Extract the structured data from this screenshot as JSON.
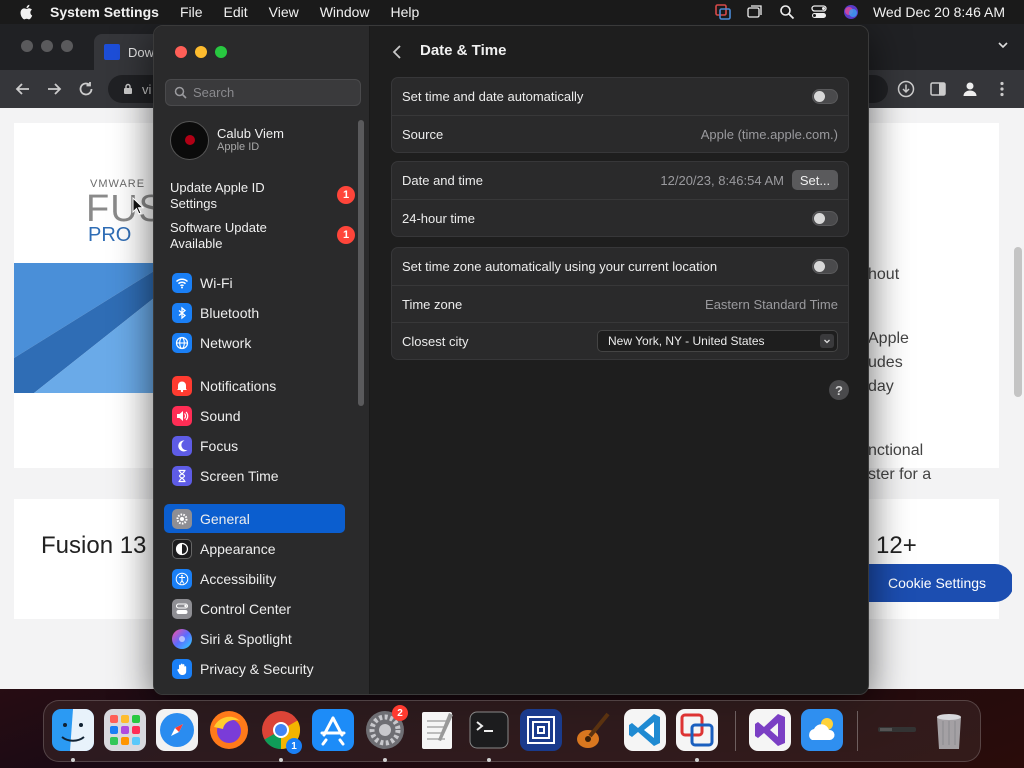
{
  "menubar": {
    "app_name": "System Settings",
    "menus": [
      "File",
      "Edit",
      "View",
      "Window",
      "Help"
    ],
    "clock": "Wed Dec 20  8:46 AM"
  },
  "browser": {
    "tab_title": "Dow",
    "omnibox_text": "vi",
    "hero": {
      "logo_brand": "VMWARE",
      "logo_product": "FUS",
      "logo_edition": "PRO",
      "right_text": [
        "hout",
        "Apple",
        "udes",
        "day",
        "nctional",
        "ster for a"
      ]
    },
    "bottom": {
      "left_heading": "Fusion 13",
      "right_heading": "12+",
      "cookie_button": "Cookie Settings"
    }
  },
  "settings": {
    "search_placeholder": "Search",
    "profile": {
      "name": "Calub Viem",
      "subtitle": "Apple ID"
    },
    "notices": [
      {
        "line1": "Update Apple ID",
        "line2": "Settings",
        "badge": "1"
      },
      {
        "line1": "Software Update",
        "line2": "Available",
        "badge": "1"
      }
    ],
    "sidebar_items": [
      {
        "label": "Wi-Fi",
        "icon": "wifi-icon",
        "color": "#1a7ff5"
      },
      {
        "label": "Bluetooth",
        "icon": "bluetooth-icon",
        "color": "#1a7ff5"
      },
      {
        "label": "Network",
        "icon": "globe-icon",
        "color": "#1a7ff5"
      },
      {
        "label": "Notifications",
        "icon": "bell-icon",
        "color": "#ff3b30"
      },
      {
        "label": "Sound",
        "icon": "speaker-icon",
        "color": "#ff2d55"
      },
      {
        "label": "Focus",
        "icon": "moon-icon",
        "color": "#5e5ce6"
      },
      {
        "label": "Screen Time",
        "icon": "hourglass-icon",
        "color": "#5e5ce6"
      },
      {
        "label": "General",
        "icon": "gear-icon",
        "color": "#8e8e93",
        "active": true
      },
      {
        "label": "Appearance",
        "icon": "appearance-icon",
        "color": "#1c1c1e"
      },
      {
        "label": "Accessibility",
        "icon": "accessibility-icon",
        "color": "#1a7ff5"
      },
      {
        "label": "Control Center",
        "icon": "control-center-icon",
        "color": "#8e8e93"
      },
      {
        "label": "Siri & Spotlight",
        "icon": "siri-icon",
        "color": "#b04be0"
      },
      {
        "label": "Privacy & Security",
        "icon": "hand-icon",
        "color": "#1a7ff5"
      }
    ],
    "content": {
      "title": "Date & Time",
      "group1": {
        "set_auto_label": "Set time and date automatically",
        "set_auto_on": false,
        "source_label": "Source",
        "source_value": "Apple (time.apple.com.)"
      },
      "group2": {
        "date_time_label": "Date and time",
        "date_time_value": "12/20/23, 8:46:54 AM",
        "set_button": "Set...",
        "hour24_label": "24-hour time",
        "hour24_on": false
      },
      "group3": {
        "auto_tz_label": "Set time zone automatically using your current location",
        "auto_tz_on": false,
        "tz_label": "Time zone",
        "tz_value": "Eastern Standard Time",
        "city_label": "Closest city",
        "city_value": "New York, NY - United States"
      },
      "help_label": "?"
    }
  },
  "dock": {
    "apps": [
      {
        "name": "Finder",
        "icon": "finder-icon",
        "running": true
      },
      {
        "name": "Launchpad",
        "icon": "launchpad-icon",
        "running": false
      },
      {
        "name": "Safari",
        "icon": "safari-icon",
        "running": false
      },
      {
        "name": "Firefox",
        "icon": "firefox-icon",
        "running": false
      },
      {
        "name": "Chrome",
        "icon": "chrome-icon",
        "running": true,
        "badge": "1"
      },
      {
        "name": "App Store",
        "icon": "app-store-icon",
        "running": false
      },
      {
        "name": "System Settings",
        "icon": "system-settings-icon",
        "running": true,
        "badge": "2"
      },
      {
        "name": "TextEdit",
        "icon": "textedit-icon",
        "running": false
      },
      {
        "name": "Terminal",
        "icon": "terminal-icon",
        "running": true
      },
      {
        "name": "VMware Fusion",
        "icon": "vmware-fusion-icon",
        "running": false
      },
      {
        "name": "GarageBand",
        "icon": "garageband-icon",
        "running": false
      },
      {
        "name": "VS Code",
        "icon": "vscode-icon",
        "running": false
      },
      {
        "name": "Parallels",
        "icon": "parallels-icon",
        "running": true
      },
      {
        "name": "Visual Studio",
        "icon": "visual-studio-icon",
        "running": false
      },
      {
        "name": "Weather",
        "icon": "weather-icon",
        "running": false
      },
      {
        "name": "Downloads",
        "icon": "downloads-stack-icon",
        "running": false
      },
      {
        "name": "Trash",
        "icon": "trash-icon",
        "running": false
      }
    ]
  }
}
